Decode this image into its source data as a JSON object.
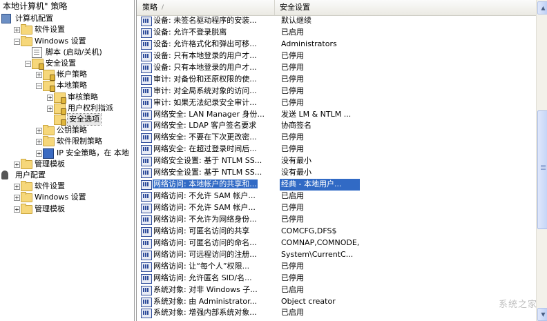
{
  "tree": {
    "items": [
      {
        "label": "本地计算机\" 策略",
        "icon": "",
        "level": 0
      },
      {
        "label": "计算机配置",
        "icon": "computer-icon",
        "level": 0
      },
      {
        "label": "软件设置",
        "icon": "folder-icon",
        "level": 1,
        "expander": "+"
      },
      {
        "label": "Windows 设置",
        "icon": "folder-icon",
        "level": 1,
        "expander": "-"
      },
      {
        "label": "脚本 (启动/关机)",
        "icon": "script-icon",
        "level": 2
      },
      {
        "label": "安全设置",
        "icon": "lock-folder-icon",
        "level": 2,
        "expander": "-"
      },
      {
        "label": "帐户策略",
        "icon": "lock-folder-icon",
        "level": 3,
        "expander": "+"
      },
      {
        "label": "本地策略",
        "icon": "lock-folder-icon",
        "level": 3,
        "expander": "-"
      },
      {
        "label": "审核策略",
        "icon": "lock-folder-icon",
        "level": 4,
        "expander": "+"
      },
      {
        "label": "用户权利指派",
        "icon": "lock-folder-icon",
        "level": 4,
        "expander": "+"
      },
      {
        "label": "安全选项",
        "icon": "lock-folder-icon",
        "level": 4,
        "selected": true
      },
      {
        "label": "公钥策略",
        "icon": "folder-icon",
        "level": 3,
        "expander": "+"
      },
      {
        "label": "软件限制策略",
        "icon": "folder-icon",
        "level": 3,
        "expander": "+"
      },
      {
        "label": "IP 安全策略，在 本地",
        "icon": "ipsec-icon",
        "level": 3,
        "expander": "+"
      },
      {
        "label": "管理模板",
        "icon": "folder-icon",
        "level": 1,
        "expander": "+"
      },
      {
        "label": "用户配置",
        "icon": "user-icon",
        "level": 0
      },
      {
        "label": "软件设置",
        "icon": "folder-icon",
        "level": 1,
        "expander": "+"
      },
      {
        "label": "Windows 设置",
        "icon": "folder-icon",
        "level": 1,
        "expander": "+"
      },
      {
        "label": "管理模板",
        "icon": "folder-icon",
        "level": 1,
        "expander": "+"
      }
    ]
  },
  "list": {
    "columns": [
      {
        "label": "策略",
        "sort_indicator": "/"
      },
      {
        "label": "安全设置"
      }
    ],
    "rows": [
      {
        "policy": "设备: 未签名驱动程序的安装...",
        "setting": "默认继续"
      },
      {
        "policy": "设备: 允许不登录脱离",
        "setting": "已启用"
      },
      {
        "policy": "设备: 允许格式化和弹出可移...",
        "setting": "Administrators"
      },
      {
        "policy": "设备: 只有本地登录的用户才...",
        "setting": "已停用"
      },
      {
        "policy": "设备: 只有本地登录的用户才...",
        "setting": "已停用"
      },
      {
        "policy": "审计: 对备份和还原权限的使...",
        "setting": "已停用"
      },
      {
        "policy": "审计: 对全局系统对象的访问...",
        "setting": "已停用"
      },
      {
        "policy": "审计: 如果无法纪录安全审计...",
        "setting": "已停用"
      },
      {
        "policy": "网络安全: LAN Manager 身份...",
        "setting": "发送 LM & NTLM ..."
      },
      {
        "policy": "网络安全: LDAP 客户签名要求",
        "setting": "协商签名"
      },
      {
        "policy": "网络安全: 不要在下次更改密...",
        "setting": "已停用"
      },
      {
        "policy": "网络安全: 在超过登录时间后...",
        "setting": "已停用"
      },
      {
        "policy": "网络安全设置: 基于 NTLM SS...",
        "setting": "没有最小"
      },
      {
        "policy": "网络安全设置: 基于 NTLM SS...",
        "setting": "没有最小"
      },
      {
        "policy": "网络访问: 本地帐户的共享和...",
        "setting": "经典 - 本地用户...",
        "selected": true
      },
      {
        "policy": "网络访问: 不允许 SAM 帐户...",
        "setting": "已启用"
      },
      {
        "policy": "网络访问: 不允许 SAM 帐户...",
        "setting": "已停用"
      },
      {
        "policy": "网络访问: 不允许为网络身份...",
        "setting": "已停用"
      },
      {
        "policy": "网络访问: 可匿名访问的共享",
        "setting": "COMCFG,DFS$"
      },
      {
        "policy": "网络访问: 可匿名访问的命名...",
        "setting": "COMNAP,COMNODE,..."
      },
      {
        "policy": "网络访问: 可远程访问的注册...",
        "setting": "System\\CurrentC..."
      },
      {
        "policy": "网络访问: 让“每个人”权限...",
        "setting": "已停用"
      },
      {
        "policy": "网络访问: 允许匿名 SID/名...",
        "setting": "已停用"
      },
      {
        "policy": "系统对象: 对非 Windows 子...",
        "setting": "已启用"
      },
      {
        "policy": "系统对象: 由 Administrator...",
        "setting": "Object creator"
      },
      {
        "policy": "系统对象: 增强内部系统对象...",
        "setting": "已启用"
      }
    ]
  },
  "scrollbar": {
    "position_fraction": 0.55
  },
  "watermark": "系统之家"
}
